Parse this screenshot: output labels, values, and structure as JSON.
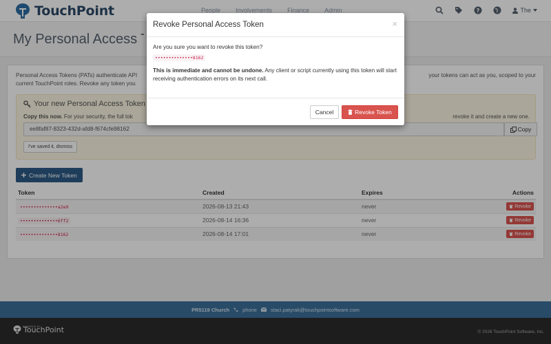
{
  "brand": {
    "name": "TouchPoint"
  },
  "nav": {
    "links": [
      "People",
      "Involvements",
      "Finance",
      "Admin"
    ],
    "user_label": "The",
    "icons": [
      "search-icon",
      "tag-icon",
      "help-icon",
      "globe-icon",
      "user-icon"
    ]
  },
  "page": {
    "title": "My Personal Access Tokens"
  },
  "intro": {
    "line1_left": "Personal Access Tokens (PATs) authenticate API",
    "line1_right": "your tokens can act as you, scoped to your",
    "line2": "current TouchPoint roles. Revoke any token you"
  },
  "alert": {
    "title": "Your new Personal Access Token",
    "copy_strong": "Copy this now.",
    "copy_text": "For your security, the full tok",
    "copy_right": "revoke it and create a new one.",
    "token_value": "ee8faf87-8323-432d-afd8-f674cfe98162",
    "copy_label": "Copy",
    "dismiss_label": "I've saved it, dismiss"
  },
  "create_label": "Create New Token",
  "table": {
    "headers": {
      "token": "Token",
      "created": "Created",
      "expires": "Expires",
      "actions": "Actions"
    },
    "rows": [
      {
        "token": "••••••••••••••a2e9",
        "created": "2026-08-13 21:43",
        "expires": "never",
        "action": "Revoke"
      },
      {
        "token": "••••••••••••••6ff2",
        "created": "2026-08-14 16:36",
        "expires": "never",
        "action": "Revoke"
      },
      {
        "token": "••••••••••••••8162",
        "created": "2026-08-14 17:01",
        "expires": "never",
        "action": "Revoke"
      }
    ]
  },
  "footer": {
    "church": "PR5119 Church",
    "phone": "phone",
    "email": "staci.patyrak@touchpointsoftware.com",
    "powered": "POWERED BY",
    "logo_text": "TouchPoint",
    "copyright": "© 2026 TouchPoint Software, Inc."
  },
  "modal": {
    "title": "Revoke Personal Access Token",
    "close": "×",
    "question": "Are you sure you want to revoke this token?",
    "token_mask": "••••••••••••••8162",
    "warn_strong": "This is immediate and cannot be undone.",
    "warn_text": " Any client or script currently using this token will start receiving authentication errors on its next call.",
    "cancel_label": "Cancel",
    "confirm_label": "Revoke Token"
  },
  "colors": {
    "primary": "#2d5b86",
    "danger": "#d9534f",
    "footer_blue": "#3b6f9a",
    "alert_bg": "#fbf5e2"
  }
}
